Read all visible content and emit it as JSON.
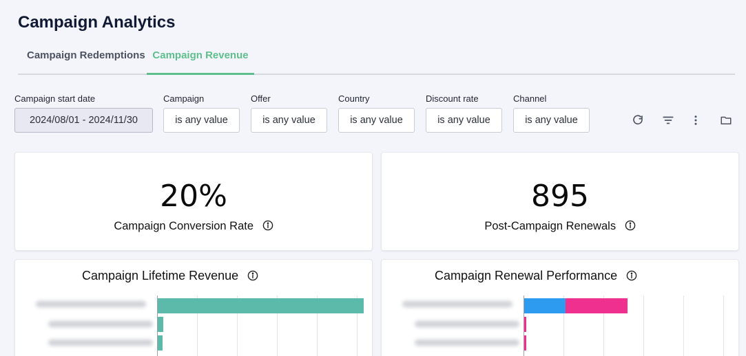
{
  "page": {
    "title": "Campaign Analytics"
  },
  "tabs": [
    {
      "label": "Campaign Redemptions",
      "active": false
    },
    {
      "label": "Campaign Revenue",
      "active": true
    }
  ],
  "colors": {
    "accent": "#5cbf8c",
    "teal_bar": "#5bbaa9",
    "blue_bar": "#2d9bf0",
    "pink_bar": "#f0308e"
  },
  "filters": [
    {
      "label": "Campaign start date",
      "value": "2024/08/01 - 2024/11/30"
    },
    {
      "label": "Campaign",
      "value": "is any value"
    },
    {
      "label": "Offer",
      "value": "is any value"
    },
    {
      "label": "Country",
      "value": "is any value"
    },
    {
      "label": "Discount rate",
      "value": "is any value"
    },
    {
      "label": "Channel",
      "value": "is any value"
    }
  ],
  "toolbar": {
    "icons": [
      "refresh-icon",
      "filter-icon",
      "more-vert-icon",
      "folder-icon"
    ]
  },
  "kpis": [
    {
      "value": "20%",
      "label": "Campaign Conversion Rate"
    },
    {
      "value": "895",
      "label": "Post-Campaign Renewals"
    }
  ],
  "charts": [
    {
      "title": "Campaign Lifetime Revenue"
    },
    {
      "title": "Campaign Renewal Performance"
    }
  ],
  "chart_data": [
    {
      "type": "bar",
      "orientation": "horizontal",
      "title": "Campaign Lifetime Revenue",
      "categories": [
        "",
        "",
        ""
      ],
      "values": [
        1.0,
        0.026,
        0.024
      ],
      "grid": true
    },
    {
      "type": "bar",
      "orientation": "horizontal",
      "stacked": true,
      "title": "Campaign Renewal Performance",
      "categories": [
        "",
        "",
        ""
      ],
      "series": [
        {
          "values": [
            0.4,
            0.0,
            0.0
          ]
        },
        {
          "values": [
            0.6,
            0.02,
            0.02
          ]
        }
      ],
      "grid": true
    }
  ]
}
